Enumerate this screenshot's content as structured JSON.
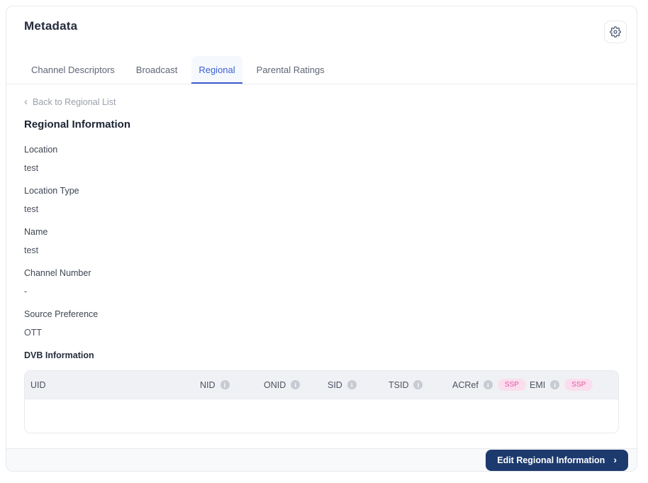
{
  "header": {
    "title": "Metadata"
  },
  "tabs": [
    {
      "label": "Channel Descriptors",
      "active": false
    },
    {
      "label": "Broadcast",
      "active": false
    },
    {
      "label": "Regional",
      "active": true
    },
    {
      "label": "Parental Ratings",
      "active": false
    }
  ],
  "back_link": {
    "chevron": "‹",
    "label": "Back to Regional List"
  },
  "section": {
    "heading": "Regional Information",
    "fields": [
      {
        "label": "Location",
        "value": "test"
      },
      {
        "label": "Location Type",
        "value": "test"
      },
      {
        "label": "Name",
        "value": "test"
      },
      {
        "label": "Channel Number",
        "value": "-"
      },
      {
        "label": "Source Preference",
        "value": "OTT"
      }
    ]
  },
  "dvb": {
    "heading": "DVB Information",
    "info_glyph": "i",
    "columns": [
      {
        "label": "UID",
        "info": false,
        "badge": null
      },
      {
        "label": "NID",
        "info": true,
        "badge": null
      },
      {
        "label": "ONID",
        "info": true,
        "badge": null
      },
      {
        "label": "SID",
        "info": true,
        "badge": null
      },
      {
        "label": "TSID",
        "info": true,
        "badge": null
      },
      {
        "label": "ACRef",
        "info": true,
        "badge": "SSP"
      },
      {
        "label": "EMI",
        "info": true,
        "badge": "SSP"
      }
    ],
    "rows": []
  },
  "footer": {
    "edit_button": {
      "label": "Edit Regional Information",
      "chevron": "›"
    }
  },
  "icons": {
    "settings": "gear-icon",
    "column_info": "info-icon",
    "back": "chevron-left-icon",
    "forward": "chevron-right-icon"
  },
  "colors": {
    "accent_blue": "#3d5ed1",
    "active_tab_bg": "#f5f8fd",
    "button_navy": "#1d3a6e",
    "badge_pink_text": "#df57a0",
    "badge_pink_bg": "#fbdeee",
    "table_header_bg": "#f0f1f4",
    "footer_bg": "#f8f9fb"
  }
}
